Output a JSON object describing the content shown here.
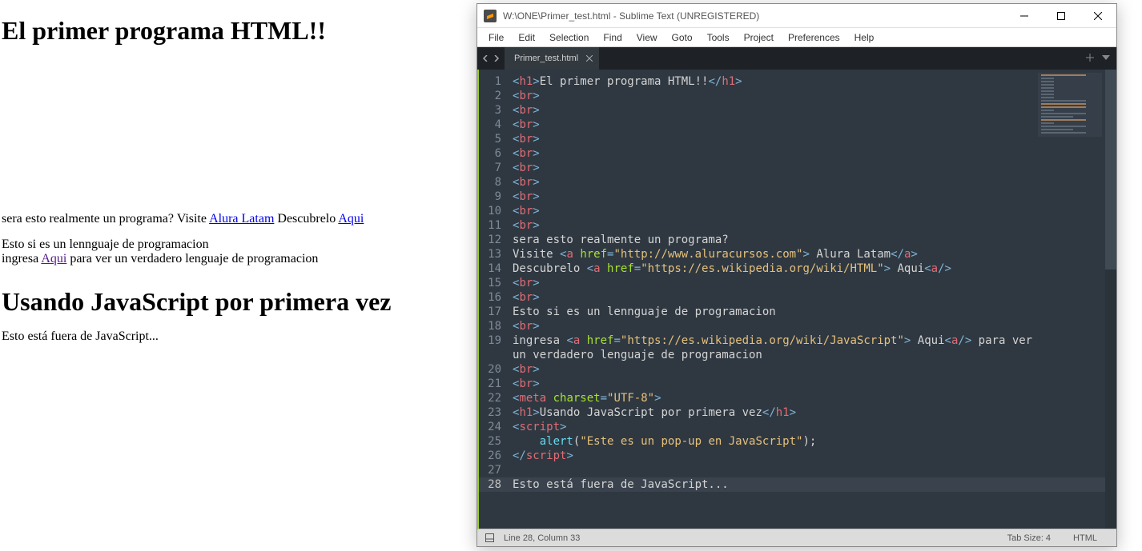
{
  "browser": {
    "heading": "El primer programa HTML!!",
    "line2_pre": "sera esto realmente un programa? Visite ",
    "link_alura": "Alura Latam",
    "line2_mid": " Descubrelo ",
    "link_aqui1": "Aqui",
    "line3": "Esto si es un lennguaje de programacion",
    "line4_pre": "ingresa ",
    "link_aqui2": "Aqui",
    "line4_post": " para ver un verdadero lenguaje de programacion",
    "heading2": "Usando JavaScript por primera vez",
    "line5": "Esto está fuera de JavaScript..."
  },
  "sublime": {
    "title": "W:\\ONE\\Primer_test.html - Sublime Text (UNREGISTERED)",
    "menu": [
      "File",
      "Edit",
      "Selection",
      "Find",
      "View",
      "Goto",
      "Tools",
      "Project",
      "Preferences",
      "Help"
    ],
    "tab_label": "Primer_test.html",
    "status_left": "Line 28, Column 33",
    "status_tabsize": "Tab Size: 4",
    "status_lang": "HTML",
    "current_line": 28,
    "code_lines": [
      {
        "n": 1,
        "seg": [
          [
            "pun",
            "<"
          ],
          [
            "tag",
            "h1"
          ],
          [
            "pun",
            ">"
          ],
          [
            "txt",
            "El primer programa HTML!!"
          ],
          [
            "pun",
            "</"
          ],
          [
            "tag",
            "h1"
          ],
          [
            "pun",
            ">"
          ]
        ]
      },
      {
        "n": 2,
        "seg": [
          [
            "pun",
            "<"
          ],
          [
            "tag",
            "br"
          ],
          [
            "pun",
            ">"
          ]
        ]
      },
      {
        "n": 3,
        "seg": [
          [
            "pun",
            "<"
          ],
          [
            "tag",
            "br"
          ],
          [
            "pun",
            ">"
          ]
        ]
      },
      {
        "n": 4,
        "seg": [
          [
            "pun",
            "<"
          ],
          [
            "tag",
            "br"
          ],
          [
            "pun",
            ">"
          ]
        ]
      },
      {
        "n": 5,
        "seg": [
          [
            "pun",
            "<"
          ],
          [
            "tag",
            "br"
          ],
          [
            "pun",
            ">"
          ]
        ]
      },
      {
        "n": 6,
        "seg": [
          [
            "pun",
            "<"
          ],
          [
            "tag",
            "br"
          ],
          [
            "pun",
            ">"
          ]
        ]
      },
      {
        "n": 7,
        "seg": [
          [
            "pun",
            "<"
          ],
          [
            "tag",
            "br"
          ],
          [
            "pun",
            ">"
          ]
        ]
      },
      {
        "n": 8,
        "seg": [
          [
            "pun",
            "<"
          ],
          [
            "tag",
            "br"
          ],
          [
            "pun",
            ">"
          ]
        ]
      },
      {
        "n": 9,
        "seg": [
          [
            "pun",
            "<"
          ],
          [
            "tag",
            "br"
          ],
          [
            "pun",
            ">"
          ]
        ]
      },
      {
        "n": 10,
        "seg": [
          [
            "pun",
            "<"
          ],
          [
            "tag",
            "br"
          ],
          [
            "pun",
            ">"
          ]
        ]
      },
      {
        "n": 11,
        "seg": [
          [
            "pun",
            "<"
          ],
          [
            "tag",
            "br"
          ],
          [
            "pun",
            ">"
          ]
        ]
      },
      {
        "n": 12,
        "seg": [
          [
            "txt",
            "sera esto realmente un programa?"
          ]
        ]
      },
      {
        "n": 13,
        "seg": [
          [
            "txt",
            "Visite "
          ],
          [
            "pun",
            "<"
          ],
          [
            "tag",
            "a"
          ],
          [
            "txt",
            " "
          ],
          [
            "attr",
            "href"
          ],
          [
            "pun",
            "="
          ],
          [
            "str",
            "\"http://www.aluracursos.com\""
          ],
          [
            "pun",
            ">"
          ],
          [
            "txt",
            " Alura Latam"
          ],
          [
            "pun",
            "</"
          ],
          [
            "tag",
            "a"
          ],
          [
            "pun",
            ">"
          ]
        ]
      },
      {
        "n": 14,
        "seg": [
          [
            "txt",
            "Descubrelo "
          ],
          [
            "pun",
            "<"
          ],
          [
            "tag",
            "a"
          ],
          [
            "txt",
            " "
          ],
          [
            "attr",
            "href"
          ],
          [
            "pun",
            "="
          ],
          [
            "str",
            "\"https://es.wikipedia.org/wiki/HTML\""
          ],
          [
            "pun",
            ">"
          ],
          [
            "txt",
            " Aqui"
          ],
          [
            "pun",
            "<"
          ],
          [
            "tag",
            "a"
          ],
          [
            "pun",
            "/>"
          ]
        ]
      },
      {
        "n": 15,
        "seg": [
          [
            "pun",
            "<"
          ],
          [
            "tag",
            "br"
          ],
          [
            "pun",
            ">"
          ]
        ]
      },
      {
        "n": 16,
        "seg": [
          [
            "pun",
            "<"
          ],
          [
            "tag",
            "br"
          ],
          [
            "pun",
            ">"
          ]
        ]
      },
      {
        "n": 17,
        "seg": [
          [
            "txt",
            "Esto si es un lennguaje de programacion"
          ]
        ]
      },
      {
        "n": 18,
        "seg": [
          [
            "pun",
            "<"
          ],
          [
            "tag",
            "br"
          ],
          [
            "pun",
            ">"
          ]
        ]
      },
      {
        "n": 19,
        "seg": [
          [
            "txt",
            "ingresa "
          ],
          [
            "pun",
            "<"
          ],
          [
            "tag",
            "a"
          ],
          [
            "txt",
            " "
          ],
          [
            "attr",
            "href"
          ],
          [
            "pun",
            "="
          ],
          [
            "str",
            "\"https://es.wikipedia.org/wiki/JavaScript\""
          ],
          [
            "pun",
            ">"
          ],
          [
            "txt",
            " Aqui"
          ],
          [
            "pun",
            "<"
          ],
          [
            "tag",
            "a"
          ],
          [
            "pun",
            "/>"
          ],
          [
            "txt",
            " para ver"
          ]
        ]
      },
      {
        "n": null,
        "seg": [
          [
            "txt",
            "un verdadero lenguaje de programacion"
          ]
        ]
      },
      {
        "n": 20,
        "seg": [
          [
            "pun",
            "<"
          ],
          [
            "tag",
            "br"
          ],
          [
            "pun",
            ">"
          ]
        ]
      },
      {
        "n": 21,
        "seg": [
          [
            "pun",
            "<"
          ],
          [
            "tag",
            "br"
          ],
          [
            "pun",
            ">"
          ]
        ]
      },
      {
        "n": 22,
        "seg": [
          [
            "pun",
            "<"
          ],
          [
            "tag",
            "meta"
          ],
          [
            "txt",
            " "
          ],
          [
            "attr",
            "charset"
          ],
          [
            "pun",
            "="
          ],
          [
            "str",
            "\"UTF-8\""
          ],
          [
            "pun",
            ">"
          ]
        ]
      },
      {
        "n": 23,
        "seg": [
          [
            "pun",
            "<"
          ],
          [
            "tag",
            "h1"
          ],
          [
            "pun",
            ">"
          ],
          [
            "txt",
            "Usando JavaScript por primera vez"
          ],
          [
            "pun",
            "</"
          ],
          [
            "tag",
            "h1"
          ],
          [
            "pun",
            ">"
          ]
        ]
      },
      {
        "n": 24,
        "seg": [
          [
            "pun",
            "<"
          ],
          [
            "tag",
            "script"
          ],
          [
            "pun",
            ">"
          ]
        ]
      },
      {
        "n": 25,
        "seg": [
          [
            "txt",
            "    "
          ],
          [
            "fn",
            "alert"
          ],
          [
            "txt",
            "("
          ],
          [
            "str",
            "\"Este es un pop-up en JavaScript\""
          ],
          [
            "txt",
            ");"
          ]
        ]
      },
      {
        "n": 26,
        "seg": [
          [
            "pun",
            "</"
          ],
          [
            "tag",
            "script"
          ],
          [
            "pun",
            ">"
          ]
        ]
      },
      {
        "n": 27,
        "seg": []
      },
      {
        "n": 28,
        "seg": [
          [
            "txt",
            "Esto está fuera de JavaScript..."
          ]
        ]
      }
    ]
  }
}
